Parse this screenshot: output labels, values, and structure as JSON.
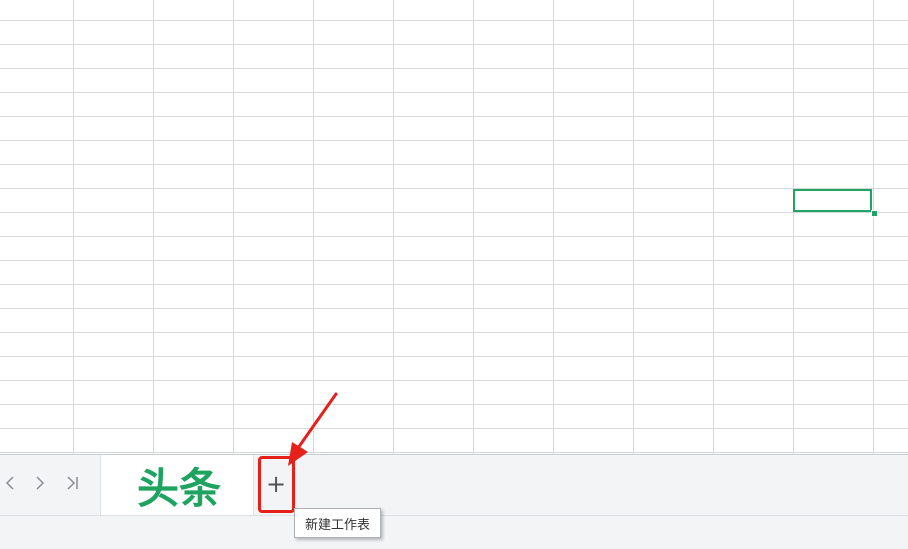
{
  "sheet": {
    "tab_label": "头条",
    "add_button_label": "+",
    "tooltip": "新建工作表"
  },
  "navigation": {
    "prev_icon": "chevron-left-icon",
    "next_icon": "chevron-right-icon",
    "last_icon": "skip-to-last-icon"
  },
  "colors": {
    "tab_label": "#1fa361",
    "selection": "#21a366",
    "highlight": "#e8201a"
  }
}
